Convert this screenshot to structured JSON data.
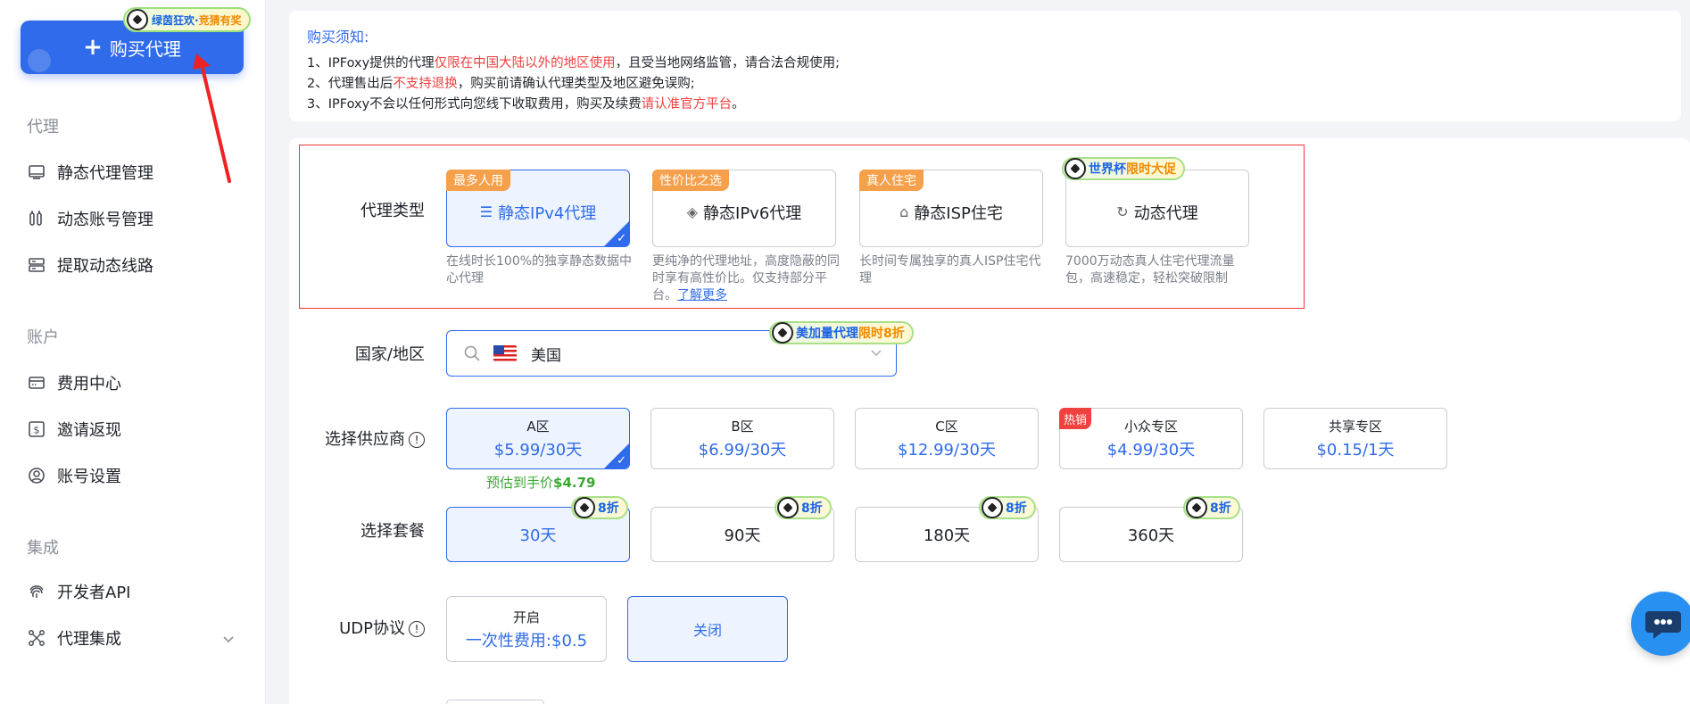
{
  "sidebar": {
    "buy_button": {
      "label": "购买代理"
    },
    "promo_badge": {
      "text_a": "绿茵狂欢·",
      "text_b": "竞猜有奖"
    },
    "groups": [
      {
        "label": "代理",
        "items": [
          {
            "label": "静态代理管理",
            "icon": "monitor-icon"
          },
          {
            "label": "动态账号管理",
            "icon": "dynamic-account-icon"
          },
          {
            "label": "提取动态线路",
            "icon": "server-icon"
          }
        ]
      },
      {
        "label": "账户",
        "items": [
          {
            "label": "费用中心",
            "icon": "card-icon"
          },
          {
            "label": "邀请返现",
            "icon": "dollar-icon"
          },
          {
            "label": "账号设置",
            "icon": "user-icon"
          }
        ]
      },
      {
        "label": "集成",
        "items": [
          {
            "label": "开发者API",
            "icon": "fingerprint-icon"
          },
          {
            "label": "代理集成",
            "icon": "integration-icon"
          }
        ]
      }
    ]
  },
  "notice": {
    "title": "购买须知:",
    "line1": {
      "a": "1、IPFoxy提供的代理",
      "b": "仅限在中国大陆以外的地区使用",
      "c": "，且受当地网络监管，请合法合规使用;"
    },
    "line2": {
      "a": "2、代理售出后",
      "b": "不支持退换",
      "c": "，购买前请确认代理类型及地区避免误购;"
    },
    "line3": {
      "a": "3、IPFoxy不会以任何形式向您线下收取费用，购买及续费",
      "b": "请认准官方平台",
      "c": "。"
    }
  },
  "proxy_type": {
    "label": "代理类型",
    "options": [
      {
        "tag": "最多人用",
        "label": "静态IPv4代理",
        "desc": "在线时长100%的独享静态数据中心代理",
        "selected": true
      },
      {
        "tag": "性价比之选",
        "label": "静态IPv6代理",
        "desc": "更纯净的代理地址，高度隐蔽的同时享有高性价比。仅支持部分平台。",
        "link": "了解更多"
      },
      {
        "tag": "真人住宅",
        "label": "静态ISP住宅",
        "desc": "长时间专属独享的真人ISP住宅代理"
      },
      {
        "label": "动态代理",
        "desc": "7000万动态真人住宅代理流量包，高速稳定，轻松突破限制"
      }
    ],
    "promo": {
      "a": "世界杯",
      "b": "限时大促"
    }
  },
  "region": {
    "label": "国家/地区",
    "value": "美国",
    "promo": {
      "a": "美加量代理",
      "b": "限时8折"
    }
  },
  "provider": {
    "label": "选择供应商",
    "options": [
      {
        "name": "A区",
        "price": "$5.99/30天",
        "selected": true
      },
      {
        "name": "B区",
        "price": "$6.99/30天"
      },
      {
        "name": "C区",
        "price": "$12.99/30天"
      },
      {
        "name": "小众专区",
        "price": "$4.99/30天",
        "tag": "热销"
      },
      {
        "name": "共享专区",
        "price": "$0.15/1天"
      }
    ],
    "price_note": {
      "a": "预估到手价",
      "b": "$4.79"
    }
  },
  "package": {
    "label": "选择套餐",
    "options": [
      {
        "label": "30天",
        "discount": "8折",
        "selected": true
      },
      {
        "label": "90天",
        "discount": "8折"
      },
      {
        "label": "180天",
        "discount": "8折"
      },
      {
        "label": "360天",
        "discount": "8折"
      }
    ]
  },
  "udp": {
    "label": "UDP协议",
    "on": {
      "title": "开启",
      "sub": "一次性费用:$0.5"
    },
    "off": {
      "label": "关闭",
      "selected": true
    }
  },
  "colors": {
    "accent": "#2f6bea",
    "warning_red": "#f0413f",
    "tag_orange": "#f6a04c",
    "price_green": "#3aa830"
  }
}
